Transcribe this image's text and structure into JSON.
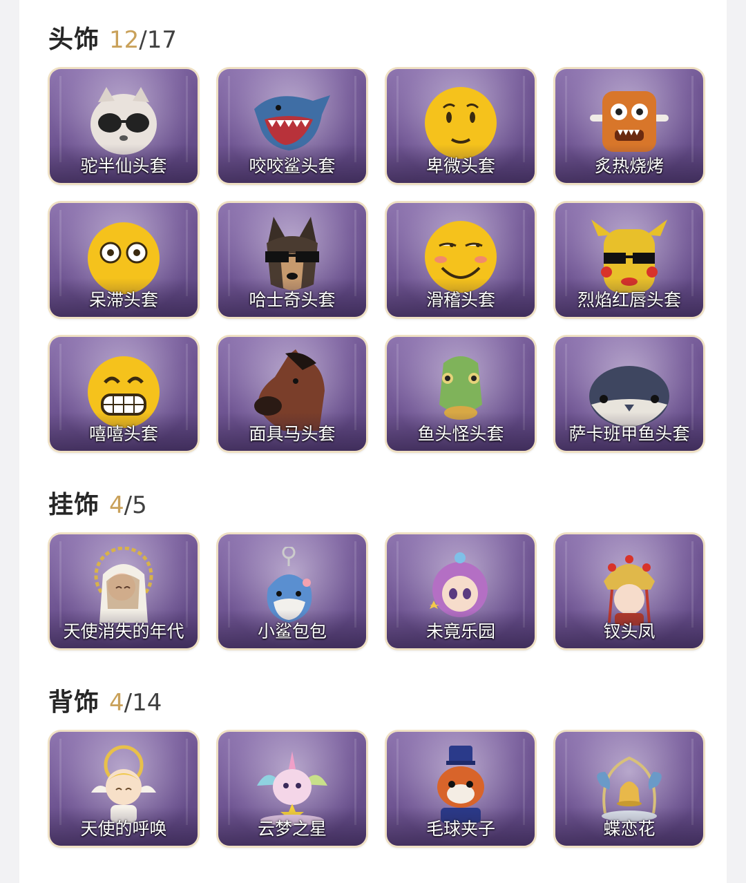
{
  "sections": [
    {
      "title": "头饰",
      "owned": "12",
      "slash": "/",
      "total": "17",
      "items": [
        {
          "name": "驼半仙头套",
          "icon": "raccoon-sunglasses-mask-icon"
        },
        {
          "name": "咬咬鲨头套",
          "icon": "shark-mask-icon"
        },
        {
          "name": "卑微头套",
          "icon": "worried-emoji-mask-icon"
        },
        {
          "name": "炙热烧烤",
          "icon": "bbq-meat-mask-icon"
        },
        {
          "name": "呆滞头套",
          "icon": "dazed-emoji-mask-icon"
        },
        {
          "name": "哈士奇头套",
          "icon": "husky-sunglasses-mask-icon"
        },
        {
          "name": "滑稽头套",
          "icon": "funny-emoji-mask-icon"
        },
        {
          "name": "烈焰红唇头套",
          "icon": "yellow-creature-sunglasses-mask-icon"
        },
        {
          "name": "嘻嘻头套",
          "icon": "grin-emoji-mask-icon"
        },
        {
          "name": "面具马头套",
          "icon": "horse-mask-icon"
        },
        {
          "name": "鱼头怪头套",
          "icon": "fish-head-mask-icon"
        },
        {
          "name": "萨卡班甲鱼头套",
          "icon": "whale-fish-mask-icon"
        }
      ]
    },
    {
      "title": "挂饰",
      "owned": "4",
      "slash": "/",
      "total": "5",
      "items": [
        {
          "name": "天使消失的年代",
          "icon": "angel-girl-pendant-icon"
        },
        {
          "name": "小鲨包包",
          "icon": "shark-bag-pendant-icon"
        },
        {
          "name": "未竟乐园",
          "icon": "purple-hair-girl-pendant-icon"
        },
        {
          "name": "钗头凤",
          "icon": "phoenix-crown-pendant-icon"
        }
      ]
    },
    {
      "title": "背饰",
      "owned": "4",
      "slash": "/",
      "total": "14",
      "items": [
        {
          "name": "天使的呼唤",
          "icon": "angel-boy-back-icon"
        },
        {
          "name": "云梦之星",
          "icon": "unicorn-star-back-icon"
        },
        {
          "name": "毛球夹子",
          "icon": "red-panda-back-icon"
        },
        {
          "name": "蝶恋花",
          "icon": "butterfly-bell-back-icon"
        }
      ]
    }
  ],
  "colors": {
    "accent_count": "#c9a15a",
    "card_border": "#efe0c3",
    "card_bg": "#6f5592"
  }
}
